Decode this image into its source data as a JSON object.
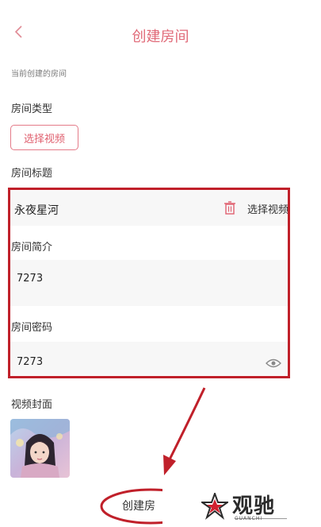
{
  "header": {
    "title": "创建房间",
    "back_icon": "chevron-left-icon"
  },
  "section_caption": "当前创建的房间",
  "room_type": {
    "label": "房间类型",
    "button_label": "选择视频"
  },
  "room_title": {
    "label": "房间标题",
    "value": "永夜星河",
    "delete_icon": "trash-icon",
    "select_video_label": "选择视频"
  },
  "room_intro": {
    "label": "房间简介",
    "value": "7273"
  },
  "room_password": {
    "label": "房间密码",
    "value": "7273",
    "visibility_icon": "eye-icon"
  },
  "video_cover": {
    "label": "视频封面"
  },
  "footer": {
    "create_button_label": "创建房"
  },
  "watermark": {
    "name": "观驰",
    "sub": "GUANCHI"
  },
  "colors": {
    "accent": "#e0606f",
    "annotation": "#c0202a",
    "field_bg": "#f7f7f7"
  }
}
